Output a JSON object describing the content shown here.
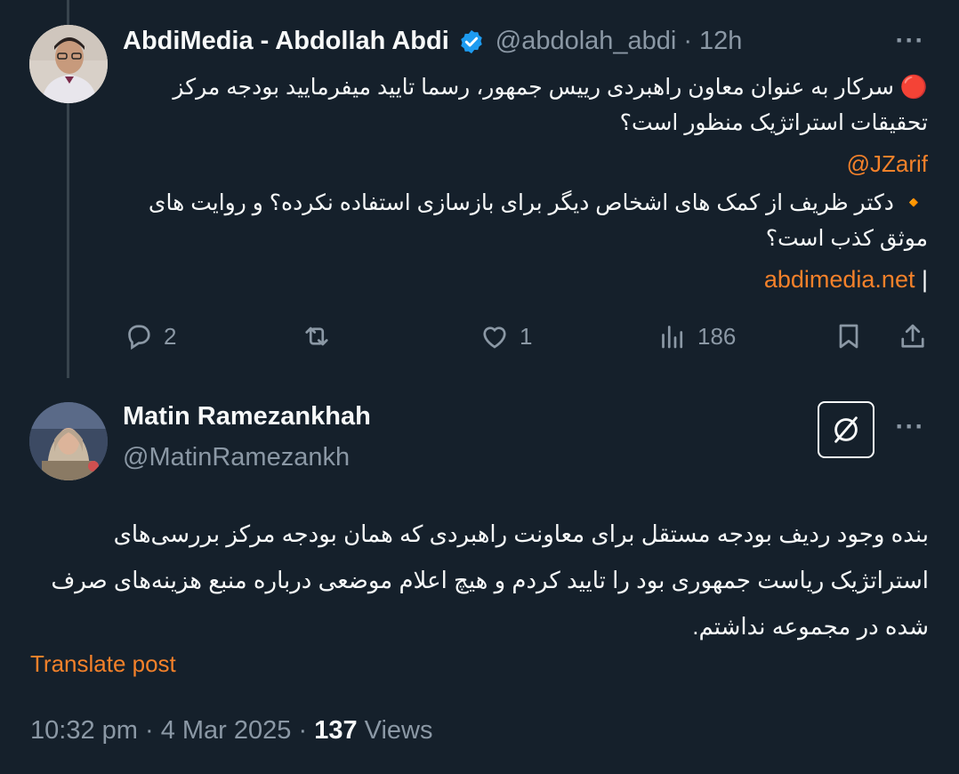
{
  "colors": {
    "background": "#15202b",
    "text": "#f7f9f9",
    "muted": "#8b98a5",
    "link": "#f4812a",
    "verified": "#1d9bf0"
  },
  "parent_post": {
    "author_name": "AbdiMedia - Abdollah Abdi",
    "author_handle": "@abdolah_abdi",
    "separator": "·",
    "time": "12h",
    "line1": "🔴 سرکار به عنوان معاون راهبردی رییس جمهور، رسما تایید میفرمایید بودجه مرکز تحقیقات استراتژیک منظور است؟",
    "mention": "@JZarif",
    "line2": "🔸 دکتر ظریف از کمک های اشخاص دیگر برای بازسازی استفاده نکرده؟ و روایت های موثق کذب است؟",
    "site_link": "abdimedia.net",
    "site_suffix": "|",
    "actions": {
      "replies": "2",
      "reposts": "",
      "likes": "1",
      "views": "186"
    }
  },
  "reply_post": {
    "author_name": "Matin Ramezankhah",
    "author_handle": "@MatinRamezankh",
    "text": "بنده وجود ردیف بودجه مستقل برای معاونت راهبردی که همان بودجه مرکز بررسی‌های استراتژیک ریاست جمهوری بود را تایید کردم و  هیچ اعلام موضعی درباره منبع هزینه‌های صرف شده در مجموعه نداشتم.",
    "translate_label": "Translate post",
    "time": "10:32 pm",
    "date": "4 Mar 2025",
    "views_count": "137",
    "views_label": "Views"
  },
  "icons": [
    "verified-badge-icon",
    "more-icon",
    "reply-icon",
    "repost-icon",
    "like-icon",
    "views-icon",
    "bookmark-icon",
    "share-icon",
    "grok-icon"
  ]
}
